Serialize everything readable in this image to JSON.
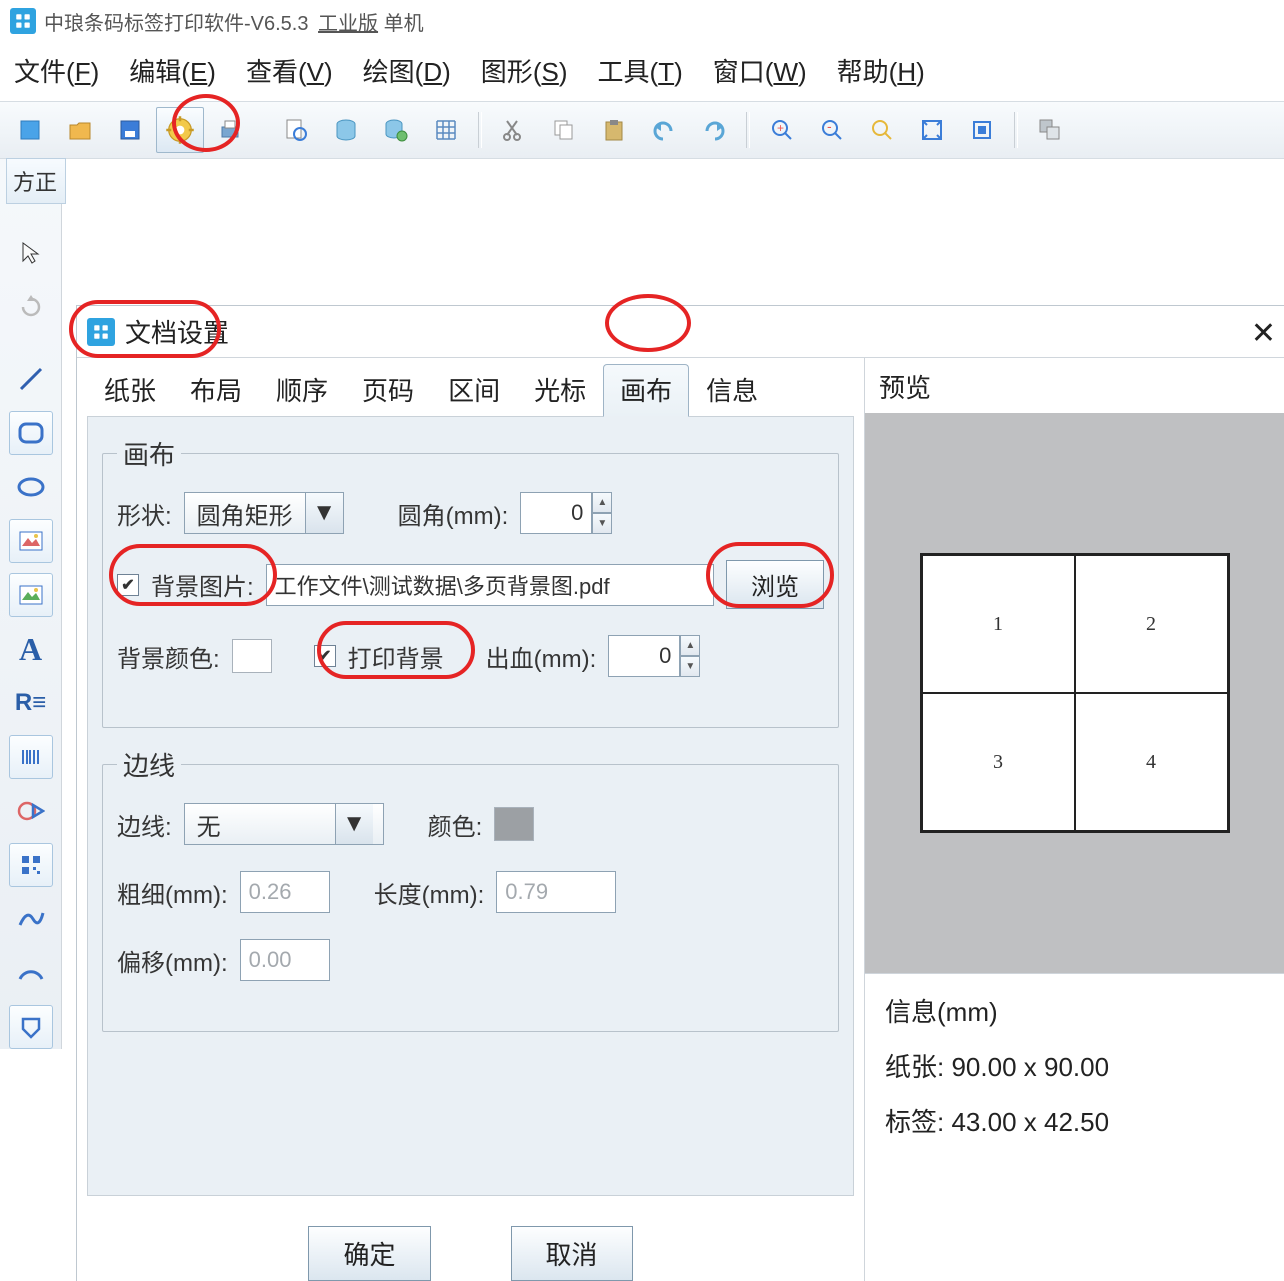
{
  "app": {
    "title": "中琅条码标签打印软件-V6.5.3",
    "edition": "工业版",
    "mode": "单机"
  },
  "menu": {
    "file": "文件",
    "file_u": "F",
    "edit": "编辑",
    "edit_u": "E",
    "view": "查看",
    "view_u": "V",
    "draw": "绘图",
    "draw_u": "D",
    "shape": "图形",
    "shape_u": "S",
    "tool": "工具",
    "tool_u": "T",
    "window": "窗口",
    "window_u": "W",
    "help": "帮助",
    "help_u": "H"
  },
  "sideDropdown": "方正",
  "dialog": {
    "title": "文档设置",
    "tabs": {
      "paper": "纸张",
      "layout": "布局",
      "order": "顺序",
      "page": "页码",
      "range": "区间",
      "cursor": "光标",
      "canvas": "画布",
      "info": "信息"
    },
    "activeTab": "canvas",
    "canvas": {
      "legend": "画布",
      "shape_lbl": "形状:",
      "shape_val": "圆角矩形",
      "radius_lbl": "圆角(mm):",
      "radius_val": "0",
      "bgimg_lbl": "背景图片:",
      "bgimg_path": "工作文件\\测试数据\\多页背景图.pdf",
      "browse": "浏览",
      "bgcolor_lbl": "背景颜色:",
      "printbg_lbl": "打印背景",
      "bleed_lbl": "出血(mm):",
      "bleed_val": "0"
    },
    "border": {
      "legend": "边线",
      "style_lbl": "边线:",
      "style_val": "无",
      "color_lbl": "颜色:",
      "thick_lbl": "粗细(mm):",
      "thick_val": "0.26",
      "length_lbl": "长度(mm):",
      "length_val": "0.79",
      "offset_lbl": "偏移(mm):",
      "offset_val": "0.00"
    },
    "ok": "确定",
    "cancel": "取消"
  },
  "preview": {
    "title": "预览",
    "cells": [
      "1",
      "2",
      "3",
      "4"
    ],
    "info_title": "信息(mm)",
    "paper_lbl": "纸张:",
    "paper_val": "90.00 x 90.00",
    "label_lbl": "标签:",
    "label_val": "43.00 x 42.50"
  }
}
